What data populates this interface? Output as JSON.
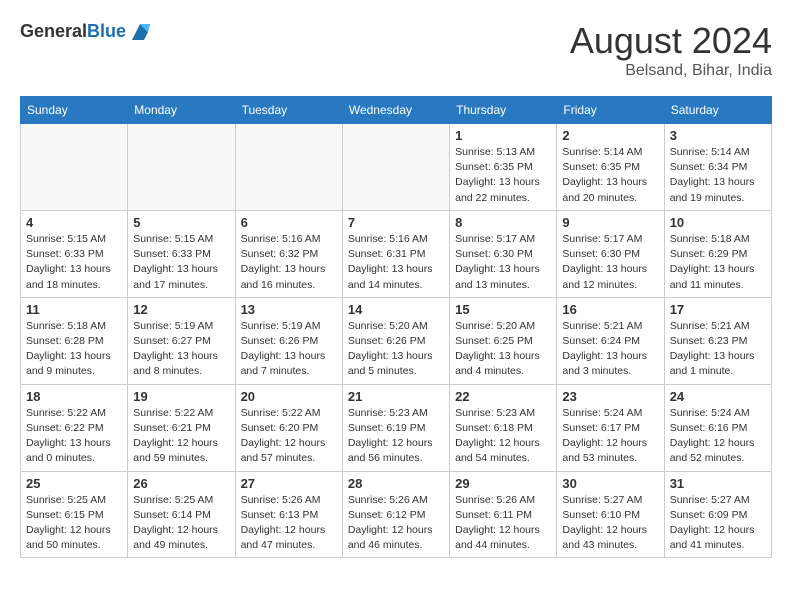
{
  "header": {
    "logo_general": "General",
    "logo_blue": "Blue",
    "month_year": "August 2024",
    "location": "Belsand, Bihar, India"
  },
  "weekdays": [
    "Sunday",
    "Monday",
    "Tuesday",
    "Wednesday",
    "Thursday",
    "Friday",
    "Saturday"
  ],
  "weeks": [
    [
      {
        "day": "",
        "info": ""
      },
      {
        "day": "",
        "info": ""
      },
      {
        "day": "",
        "info": ""
      },
      {
        "day": "",
        "info": ""
      },
      {
        "day": "1",
        "info": "Sunrise: 5:13 AM\nSunset: 6:35 PM\nDaylight: 13 hours\nand 22 minutes."
      },
      {
        "day": "2",
        "info": "Sunrise: 5:14 AM\nSunset: 6:35 PM\nDaylight: 13 hours\nand 20 minutes."
      },
      {
        "day": "3",
        "info": "Sunrise: 5:14 AM\nSunset: 6:34 PM\nDaylight: 13 hours\nand 19 minutes."
      }
    ],
    [
      {
        "day": "4",
        "info": "Sunrise: 5:15 AM\nSunset: 6:33 PM\nDaylight: 13 hours\nand 18 minutes."
      },
      {
        "day": "5",
        "info": "Sunrise: 5:15 AM\nSunset: 6:33 PM\nDaylight: 13 hours\nand 17 minutes."
      },
      {
        "day": "6",
        "info": "Sunrise: 5:16 AM\nSunset: 6:32 PM\nDaylight: 13 hours\nand 16 minutes."
      },
      {
        "day": "7",
        "info": "Sunrise: 5:16 AM\nSunset: 6:31 PM\nDaylight: 13 hours\nand 14 minutes."
      },
      {
        "day": "8",
        "info": "Sunrise: 5:17 AM\nSunset: 6:30 PM\nDaylight: 13 hours\nand 13 minutes."
      },
      {
        "day": "9",
        "info": "Sunrise: 5:17 AM\nSunset: 6:30 PM\nDaylight: 13 hours\nand 12 minutes."
      },
      {
        "day": "10",
        "info": "Sunrise: 5:18 AM\nSunset: 6:29 PM\nDaylight: 13 hours\nand 11 minutes."
      }
    ],
    [
      {
        "day": "11",
        "info": "Sunrise: 5:18 AM\nSunset: 6:28 PM\nDaylight: 13 hours\nand 9 minutes."
      },
      {
        "day": "12",
        "info": "Sunrise: 5:19 AM\nSunset: 6:27 PM\nDaylight: 13 hours\nand 8 minutes."
      },
      {
        "day": "13",
        "info": "Sunrise: 5:19 AM\nSunset: 6:26 PM\nDaylight: 13 hours\nand 7 minutes."
      },
      {
        "day": "14",
        "info": "Sunrise: 5:20 AM\nSunset: 6:26 PM\nDaylight: 13 hours\nand 5 minutes."
      },
      {
        "day": "15",
        "info": "Sunrise: 5:20 AM\nSunset: 6:25 PM\nDaylight: 13 hours\nand 4 minutes."
      },
      {
        "day": "16",
        "info": "Sunrise: 5:21 AM\nSunset: 6:24 PM\nDaylight: 13 hours\nand 3 minutes."
      },
      {
        "day": "17",
        "info": "Sunrise: 5:21 AM\nSunset: 6:23 PM\nDaylight: 13 hours\nand 1 minute."
      }
    ],
    [
      {
        "day": "18",
        "info": "Sunrise: 5:22 AM\nSunset: 6:22 PM\nDaylight: 13 hours\nand 0 minutes."
      },
      {
        "day": "19",
        "info": "Sunrise: 5:22 AM\nSunset: 6:21 PM\nDaylight: 12 hours\nand 59 minutes."
      },
      {
        "day": "20",
        "info": "Sunrise: 5:22 AM\nSunset: 6:20 PM\nDaylight: 12 hours\nand 57 minutes."
      },
      {
        "day": "21",
        "info": "Sunrise: 5:23 AM\nSunset: 6:19 PM\nDaylight: 12 hours\nand 56 minutes."
      },
      {
        "day": "22",
        "info": "Sunrise: 5:23 AM\nSunset: 6:18 PM\nDaylight: 12 hours\nand 54 minutes."
      },
      {
        "day": "23",
        "info": "Sunrise: 5:24 AM\nSunset: 6:17 PM\nDaylight: 12 hours\nand 53 minutes."
      },
      {
        "day": "24",
        "info": "Sunrise: 5:24 AM\nSunset: 6:16 PM\nDaylight: 12 hours\nand 52 minutes."
      }
    ],
    [
      {
        "day": "25",
        "info": "Sunrise: 5:25 AM\nSunset: 6:15 PM\nDaylight: 12 hours\nand 50 minutes."
      },
      {
        "day": "26",
        "info": "Sunrise: 5:25 AM\nSunset: 6:14 PM\nDaylight: 12 hours\nand 49 minutes."
      },
      {
        "day": "27",
        "info": "Sunrise: 5:26 AM\nSunset: 6:13 PM\nDaylight: 12 hours\nand 47 minutes."
      },
      {
        "day": "28",
        "info": "Sunrise: 5:26 AM\nSunset: 6:12 PM\nDaylight: 12 hours\nand 46 minutes."
      },
      {
        "day": "29",
        "info": "Sunrise: 5:26 AM\nSunset: 6:11 PM\nDaylight: 12 hours\nand 44 minutes."
      },
      {
        "day": "30",
        "info": "Sunrise: 5:27 AM\nSunset: 6:10 PM\nDaylight: 12 hours\nand 43 minutes."
      },
      {
        "day": "31",
        "info": "Sunrise: 5:27 AM\nSunset: 6:09 PM\nDaylight: 12 hours\nand 41 minutes."
      }
    ]
  ]
}
